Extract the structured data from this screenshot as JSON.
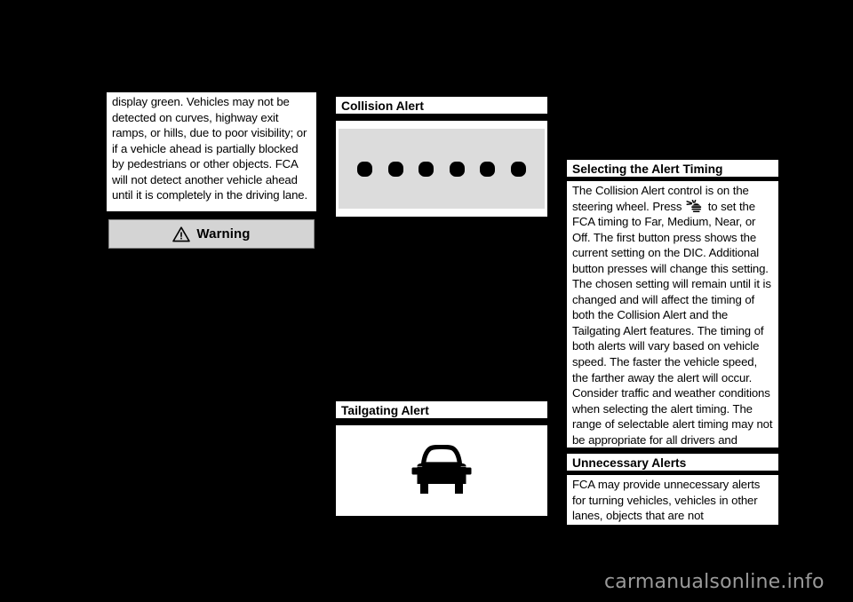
{
  "page": {
    "background_color": "#000000",
    "panel_color": "#ffffff",
    "warning_fill": "#d4d4d4",
    "figure_fill": "#dcdcdc"
  },
  "left_column": {
    "paragraph": "display green. Vehicles may not be detected on curves, highway exit ramps, or hills, due to poor visibility; or if a vehicle ahead is partially blocked by pedestrians or other objects. FCA will not detect another vehicle ahead until it is completely in the driving lane.",
    "warning": {
      "label": "Warning",
      "icon": "warning-triangle-icon"
    }
  },
  "middle_column": {
    "collision_alert": {
      "heading": "Collision Alert",
      "figure": {
        "type": "indicator-lamp-row",
        "dot_count": 6,
        "dot_color": "#000000",
        "background_color": "#dcdcdc"
      }
    },
    "tailgating_alert": {
      "heading": "Tailgating Alert",
      "figure": {
        "type": "vehicle-front-icon",
        "icon": "car-front-icon",
        "icon_color": "#000000",
        "background_color": "#ffffff"
      }
    }
  },
  "right_column": {
    "selecting_alert_timing": {
      "heading": "Selecting the Alert Timing",
      "text_before_icon": "The Collision Alert control is on the steering wheel. Press ",
      "inline_icon": "collision-alert-control-icon",
      "text_after_icon": " to set the FCA timing to Far, Medium, Near, or Off. The first button press shows the current setting on the DIC. Additional button presses will change this setting. The chosen setting will remain until it is changed and will affect the timing of both the Collision Alert and the Tailgating Alert features. The timing of both alerts will vary based on vehicle speed. The faster the vehicle speed, the farther away the alert will occur. Consider traffic and weather conditions when selecting the alert timing. The range of selectable alert timing may not be appropriate for all drivers and driving conditions."
    },
    "unnecessary_alerts": {
      "heading": "Unnecessary Alerts",
      "paragraph": "FCA may provide unnecessary alerts for turning vehicles, vehicles in other lanes, objects that are not"
    }
  },
  "footer": {
    "watermark": "carmanualsonline.info"
  }
}
